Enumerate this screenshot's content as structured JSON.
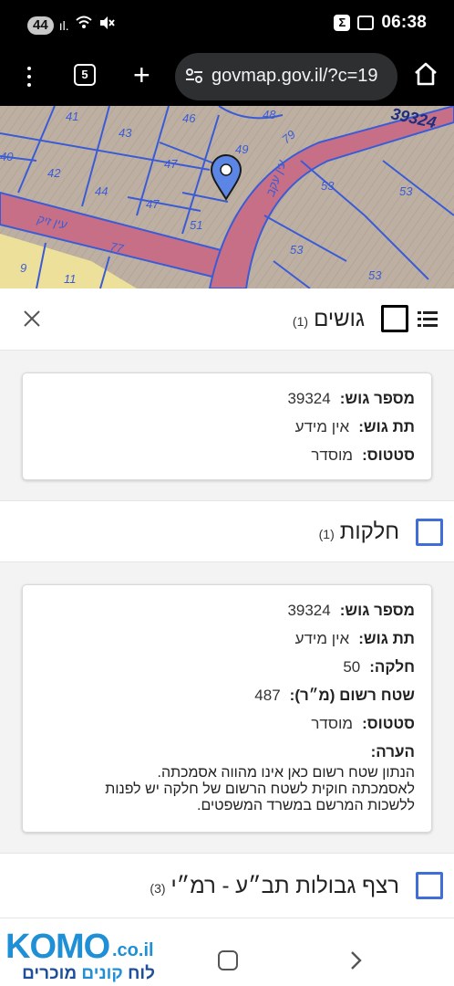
{
  "status_bar": {
    "notifications": "44",
    "time": "06:38"
  },
  "browser": {
    "tab_count": "5",
    "url": "govmap.gov.il/?c=19"
  },
  "map": {
    "parcel_labels": [
      "41",
      "46",
      "48",
      "43",
      "40",
      "42",
      "47",
      "49",
      "44",
      "47",
      "51",
      "9",
      "11",
      "53",
      "53",
      "53",
      "53"
    ],
    "block_label": "39324",
    "road_labels": [
      "עין זיק",
      "עין עקב"
    ],
    "road_codes": [
      "79",
      "77"
    ]
  },
  "sections": {
    "gushim": {
      "title": "גושים",
      "count": "(1)",
      "card": {
        "rows": [
          {
            "label": "מספר גוש:",
            "value": "39324"
          },
          {
            "label": "תת גוש:",
            "value": "אין מידע"
          },
          {
            "label": "סטטוס:",
            "value": "מוסדר"
          }
        ]
      }
    },
    "helkot": {
      "title": "חלקות",
      "count": "(1)",
      "card": {
        "rows": [
          {
            "label": "מספר גוש:",
            "value": "39324"
          },
          {
            "label": "תת גוש:",
            "value": "אין מידע"
          },
          {
            "label": "חלקה:",
            "value": "50"
          },
          {
            "label": "שטח רשום (מ״ר):",
            "value": "487"
          },
          {
            "label": "סטטוס:",
            "value": "מוסדר"
          }
        ],
        "note_label": "הערה:",
        "note_lines": [
          "הנתון שטח רשום כאן אינו מהווה אסמכתה.",
          "לאסמכתה חוקית לשטח הרשום של חלקה יש לפנות",
          "ללשכות המרשם במשרד המשפטים."
        ]
      }
    },
    "tabaa": {
      "title": "רצף גבולות תב״ע - רמ״י",
      "count": "(3)"
    }
  },
  "watermark": {
    "brand": "KOMO",
    "suffix": ".co.il",
    "tag_part1": "לוח ",
    "tag_part2": "קונים",
    "tag_part3": " מוכרים"
  }
}
